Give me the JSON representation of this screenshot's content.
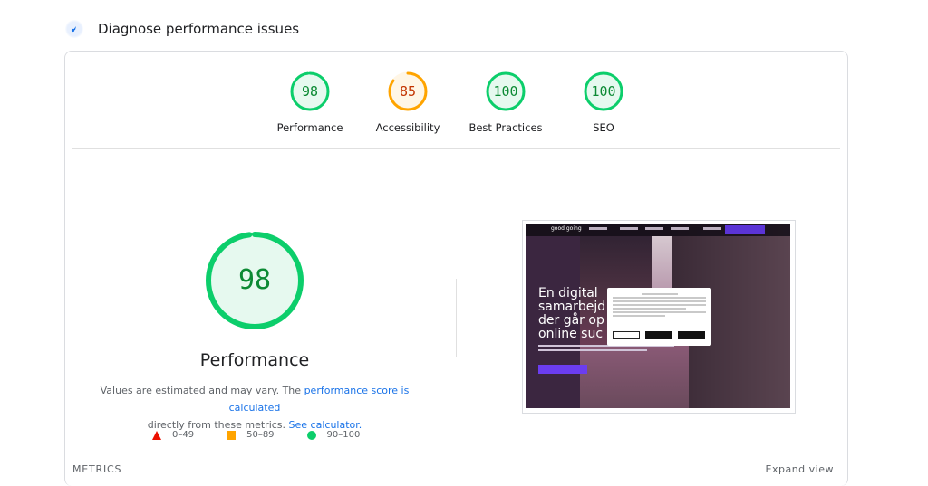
{
  "header": {
    "title": "Diagnose performance issues",
    "icon": "lighthouse-icon"
  },
  "scores": [
    {
      "value": "98",
      "label": "Performance",
      "ratio": 0.98,
      "stroke": "#0cce6b",
      "fill": "#e6f9ef",
      "text_color": "#0c8a34"
    },
    {
      "value": "85",
      "label": "Accessibility",
      "ratio": 0.85,
      "stroke": "#ffa400",
      "fill": "#fff6e6",
      "text_color": "#c33300"
    },
    {
      "value": "100",
      "label": "Best Practices",
      "ratio": 1.0,
      "stroke": "#0cce6b",
      "fill": "#e6f9ef",
      "text_color": "#0c8a34"
    },
    {
      "value": "100",
      "label": "SEO",
      "ratio": 1.0,
      "stroke": "#0cce6b",
      "fill": "#e6f9ef",
      "text_color": "#0c8a34"
    }
  ],
  "performance": {
    "score": "98",
    "ratio": 0.98,
    "title": "Performance",
    "desc_1": "Values are estimated and may vary. The",
    "desc_link_1": "performance score is calculated",
    "desc_2": "directly from these metrics.",
    "desc_link_2": "See calculator."
  },
  "legend": {
    "fail": "0–49",
    "average": "50–89",
    "pass": "90–100"
  },
  "screenshot": {
    "hero_lines": [
      "En digital",
      "samarbejd",
      "der går op",
      "online suc"
    ],
    "logo": "good going"
  },
  "metrics": {
    "label": "METRICS",
    "expand": "Expand view"
  },
  "colors": {
    "pass": "#0cce6b",
    "average": "#ffa400",
    "fail": "#eb0f00",
    "link": "#1a73e8"
  }
}
